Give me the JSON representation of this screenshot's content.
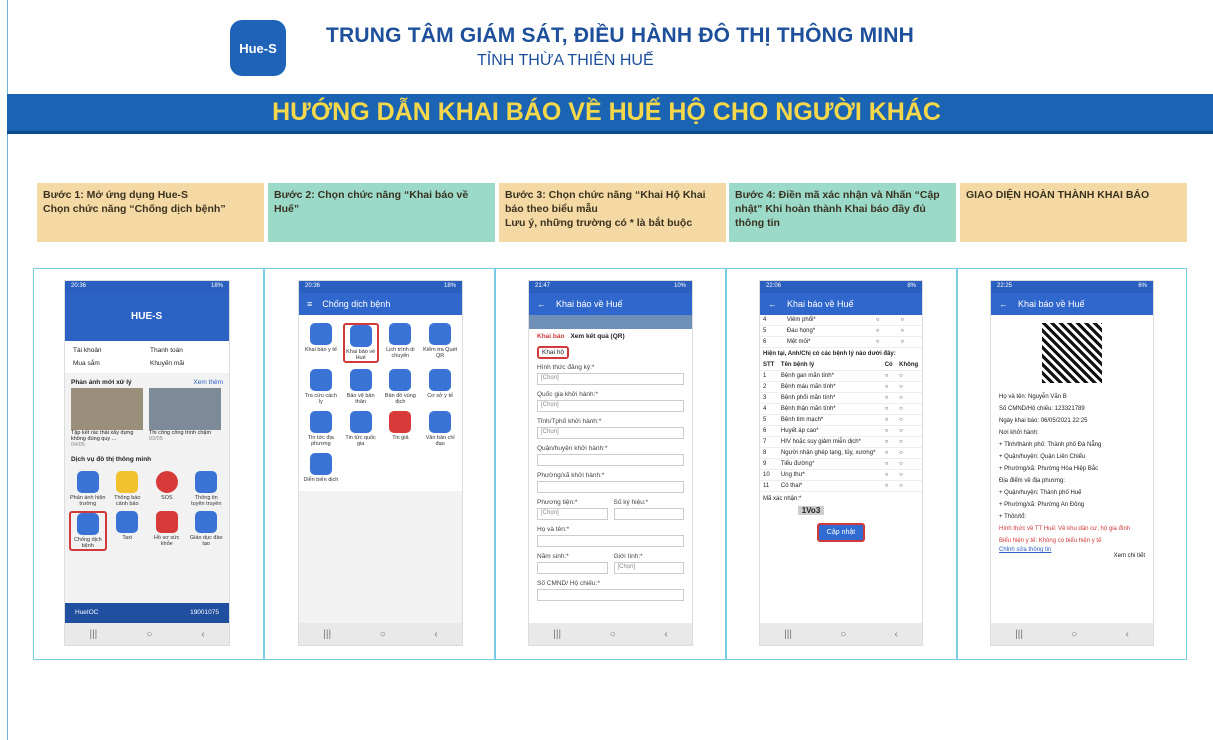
{
  "header": {
    "logo": "Hue-S",
    "title": "TRUNG TÂM GIÁM SÁT, ĐIỀU HÀNH ĐÔ THỊ THÔNG MINH",
    "subtitle": "TỈNH THỪA THIÊN HUẾ",
    "banner": "HƯỚNG DẪN KHAI BÁO VỀ HUẾ HỘ CHO NGƯỜI KHÁC"
  },
  "steps": [
    "Bước 1: Mở ứng dụng Hue-S\nChọn chức năng “Chống dịch bệnh”",
    "Bước 2: Chọn chức năng “Khai báo về Huế”",
    "Bước 3: Chọn chức năng “Khai Hộ Khai báo theo biểu mẫu\nLưu ý, những trường có * là bắt buộc",
    "Bước 4: Điền mã xác nhận và Nhấn “Cập nhật” Khi hoàn thành Khai báo đầy đủ thông tin",
    "GIAO DIỆN HOÀN THÀNH KHAI BÁO"
  ],
  "p1": {
    "time": "20:36",
    "battery": "18%",
    "app": "HUE-S",
    "menu": [
      "Tài khoản",
      "Thanh toán",
      "Mua sắm",
      "Khuyến mãi"
    ],
    "news_title": "Phản ánh mới xử lý",
    "see_more": "Xem thêm",
    "news": [
      "Tập kết rác thải xây dựng không đúng quy ...",
      "Thi công công trình chậm"
    ],
    "dates": [
      "04/05",
      "03/05"
    ],
    "services_title": "Dịch vụ đô thị thông minh",
    "services": [
      "Phản ánh hiện trường",
      "Thông báo cảnh báo",
      "SOS",
      "Thông tin tuyên truyền",
      "Chống dịch bệnh",
      "Taxi",
      "Hồ sơ sức khỏe",
      "Giáo dục đào tạo"
    ],
    "footer_left": "HueIOC",
    "footer_right": "19001075"
  },
  "p2": {
    "time": "20:36",
    "battery": "18%",
    "title": "Chống dịch bệnh",
    "items": [
      "Khai báo y tế",
      "Khai báo về Huế",
      "Lịch trình di chuyển",
      "Kiểm tra Quét QR",
      "Tra cứu cách ly",
      "Bảo vệ bản thân",
      "Bản đồ vùng dịch",
      "Cơ sở y tế",
      "Tin tức địa phương",
      "Tin tức quốc gia",
      "Tin giả",
      "Văn bản chỉ đạo",
      "Diễn biến dịch"
    ]
  },
  "p3": {
    "time": "21:47",
    "battery": "10%",
    "title": "Khai báo về Huế",
    "tabs": [
      "Khai báo",
      "Xem kết quả (QR)"
    ],
    "check": "Khai hộ",
    "fields": [
      "Hình thức đăng ký:*",
      "Quốc gia khởi hành:*",
      "Tỉnh/Tphố khởi hành:*",
      "Quận/huyện khởi hành:*",
      "Phường/xã khởi hành:*",
      "Phương tiện:*",
      "Số ký hiệu:*",
      "Họ và tên:*",
      "Năm sinh:*",
      "Giới tính:*",
      "Số CMND/ Hộ chiếu:*"
    ],
    "choose": "[Chọn]"
  },
  "p4": {
    "time": "22:06",
    "battery": "8%",
    "title": "Khai báo về Huế",
    "top_rows": [
      "Viêm phổi*",
      "Đau họng*",
      "Mệt mỏi*"
    ],
    "question": "Hiện tại, Anh/Chị có các bệnh lý nào dưới đây:",
    "cols": [
      "STT",
      "Tên bệnh lý",
      "Có",
      "Không"
    ],
    "rows": [
      "Bệnh gan mãn tính*",
      "Bệnh máu mãn tính*",
      "Bệnh phổi mãn tính*",
      "Bệnh thận mãn tính*",
      "Bệnh tim mạch*",
      "Huyết áp cao*",
      "HIV hoặc suy giảm miễn dịch*",
      "Người nhận ghép tạng, tủy, xương*",
      "Tiểu đường*",
      "Ung thư*",
      "Có thai*"
    ],
    "captcha_label": "Mã xác nhận:*",
    "captcha": "1Vo3",
    "submit": "Cập nhật"
  },
  "p5": {
    "time": "22:25",
    "battery": "6%",
    "title": "Khai báo về Huế",
    "lines": [
      "Họ và tên: Nguyễn Văn B",
      "Số CMND/Hộ chiếu: 123321789",
      "Ngày khai báo: 06/05/2021 22:25",
      "Nơi khởi hành:",
      "+ Tỉnh/thành phố: Thành phố Đà Nẵng",
      "+ Quận/huyện: Quận Liên Chiểu",
      "+ Phường/xã: Phường Hòa Hiệp Bắc",
      "Địa điểm về địa phương:",
      "+ Quận/huyện: Thành phố Huế",
      "+ Phường/xã: Phường An Đông",
      "+ Thôn/tổ:",
      "Hình thức về TT Huế: Về khu dân cư, hộ gia đình",
      "Biểu hiện y tế: Không có biểu hiện y tế"
    ],
    "edit": "Chỉnh sửa thông tin",
    "detail": "Xem chi tiết"
  },
  "colors": {
    "blue": "#1a64b3",
    "yellow": "#f4d74a"
  }
}
